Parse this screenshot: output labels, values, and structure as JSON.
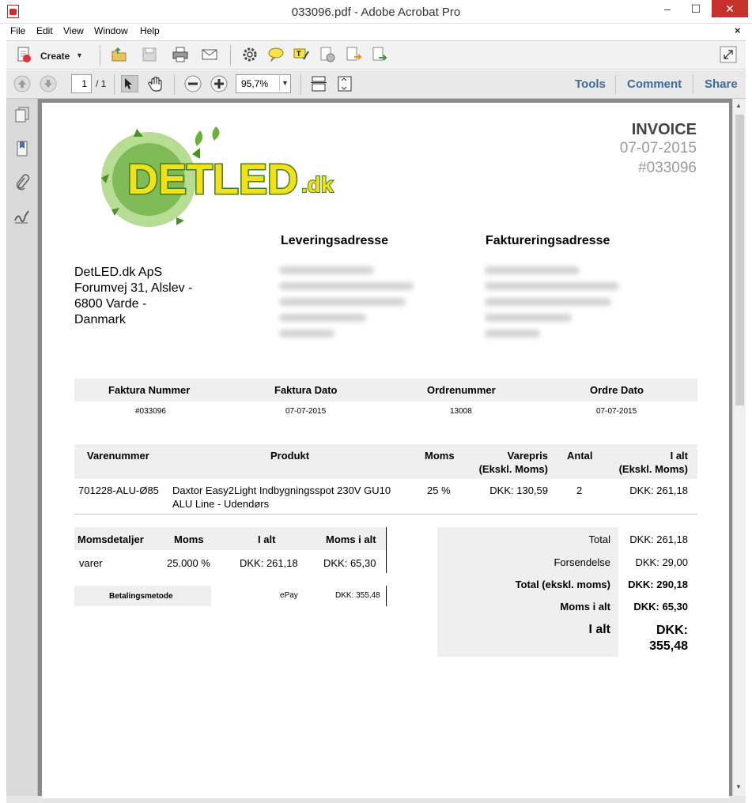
{
  "window": {
    "title": "033096.pdf - Adobe Acrobat Pro",
    "minimize": "–",
    "maximize": "☐",
    "close": "✕",
    "doc_close": "×"
  },
  "menu": [
    "File",
    "Edit",
    "View",
    "Window",
    "Help"
  ],
  "toolbar": {
    "create_label": "Create",
    "dropdown_glyph": "▼"
  },
  "nav": {
    "page_current": "1",
    "page_total": "/ 1",
    "zoom": "95,7%"
  },
  "panes": [
    "Tools",
    "Comment",
    "Share"
  ],
  "invoice": {
    "title": "INVOICE",
    "date": "07-07-2015",
    "number": "#033096",
    "seller_lines": [
      "DetLED.dk ApS",
      "Forumvej 31, Alslev -",
      "6800 Varde -",
      "Danmark"
    ],
    "delivery_heading": "Leveringsadresse",
    "billing_heading": "Faktureringsadresse",
    "meta_headers": [
      "Faktura Nummer",
      "Faktura Dato",
      "Ordrenummer",
      "Ordre Dato"
    ],
    "meta_values": [
      "#033096",
      "07-07-2015",
      "13008",
      "07-07-2015"
    ],
    "item_headers": {
      "varenummer": "Varenummer",
      "produkt": "Produkt",
      "moms": "Moms",
      "varepris_1": "Varepris",
      "varepris_2": "(Ekskl. Moms)",
      "antal": "Antal",
      "ialt_1": "I alt",
      "ialt_2": "(Ekskl. Moms)"
    },
    "item": {
      "sku": "701228-ALU-Ø85",
      "product_line1": "Daxtor Easy2Light Indbygningsspot 230V GU10",
      "product_line2": "ALU Line - Udendørs",
      "vat": "25 %",
      "price": "DKK: 130,59",
      "qty": "2",
      "total": "DKK: 261,18"
    },
    "vat_headers": [
      "Momsdetaljer",
      "Moms",
      "I alt",
      "Moms i alt"
    ],
    "vat_row": [
      "varer",
      "25.000 %",
      "DKK: 261,18",
      "DKK: 65,30"
    ],
    "payment": {
      "label": "Betalingsmetode",
      "method": "ePay",
      "amount": "DKK: 355,48"
    },
    "totals": [
      {
        "label": "Total",
        "value": "DKK: 261,18"
      },
      {
        "label": "Forsendelse",
        "value": "DKK: 29,00"
      },
      {
        "label": "Total (ekskl. moms)",
        "value": "DKK: 290,18"
      },
      {
        "label": "Moms i alt",
        "value": "DKK: 65,30"
      }
    ],
    "grand_total": {
      "label": "I alt",
      "value_line1": "DKK:",
      "value_line2": "355,48"
    }
  },
  "logo": {
    "text": "DETLED",
    "suffix": ".dk",
    "green": "#4a9a2e",
    "yellow": "#f2e01b"
  }
}
